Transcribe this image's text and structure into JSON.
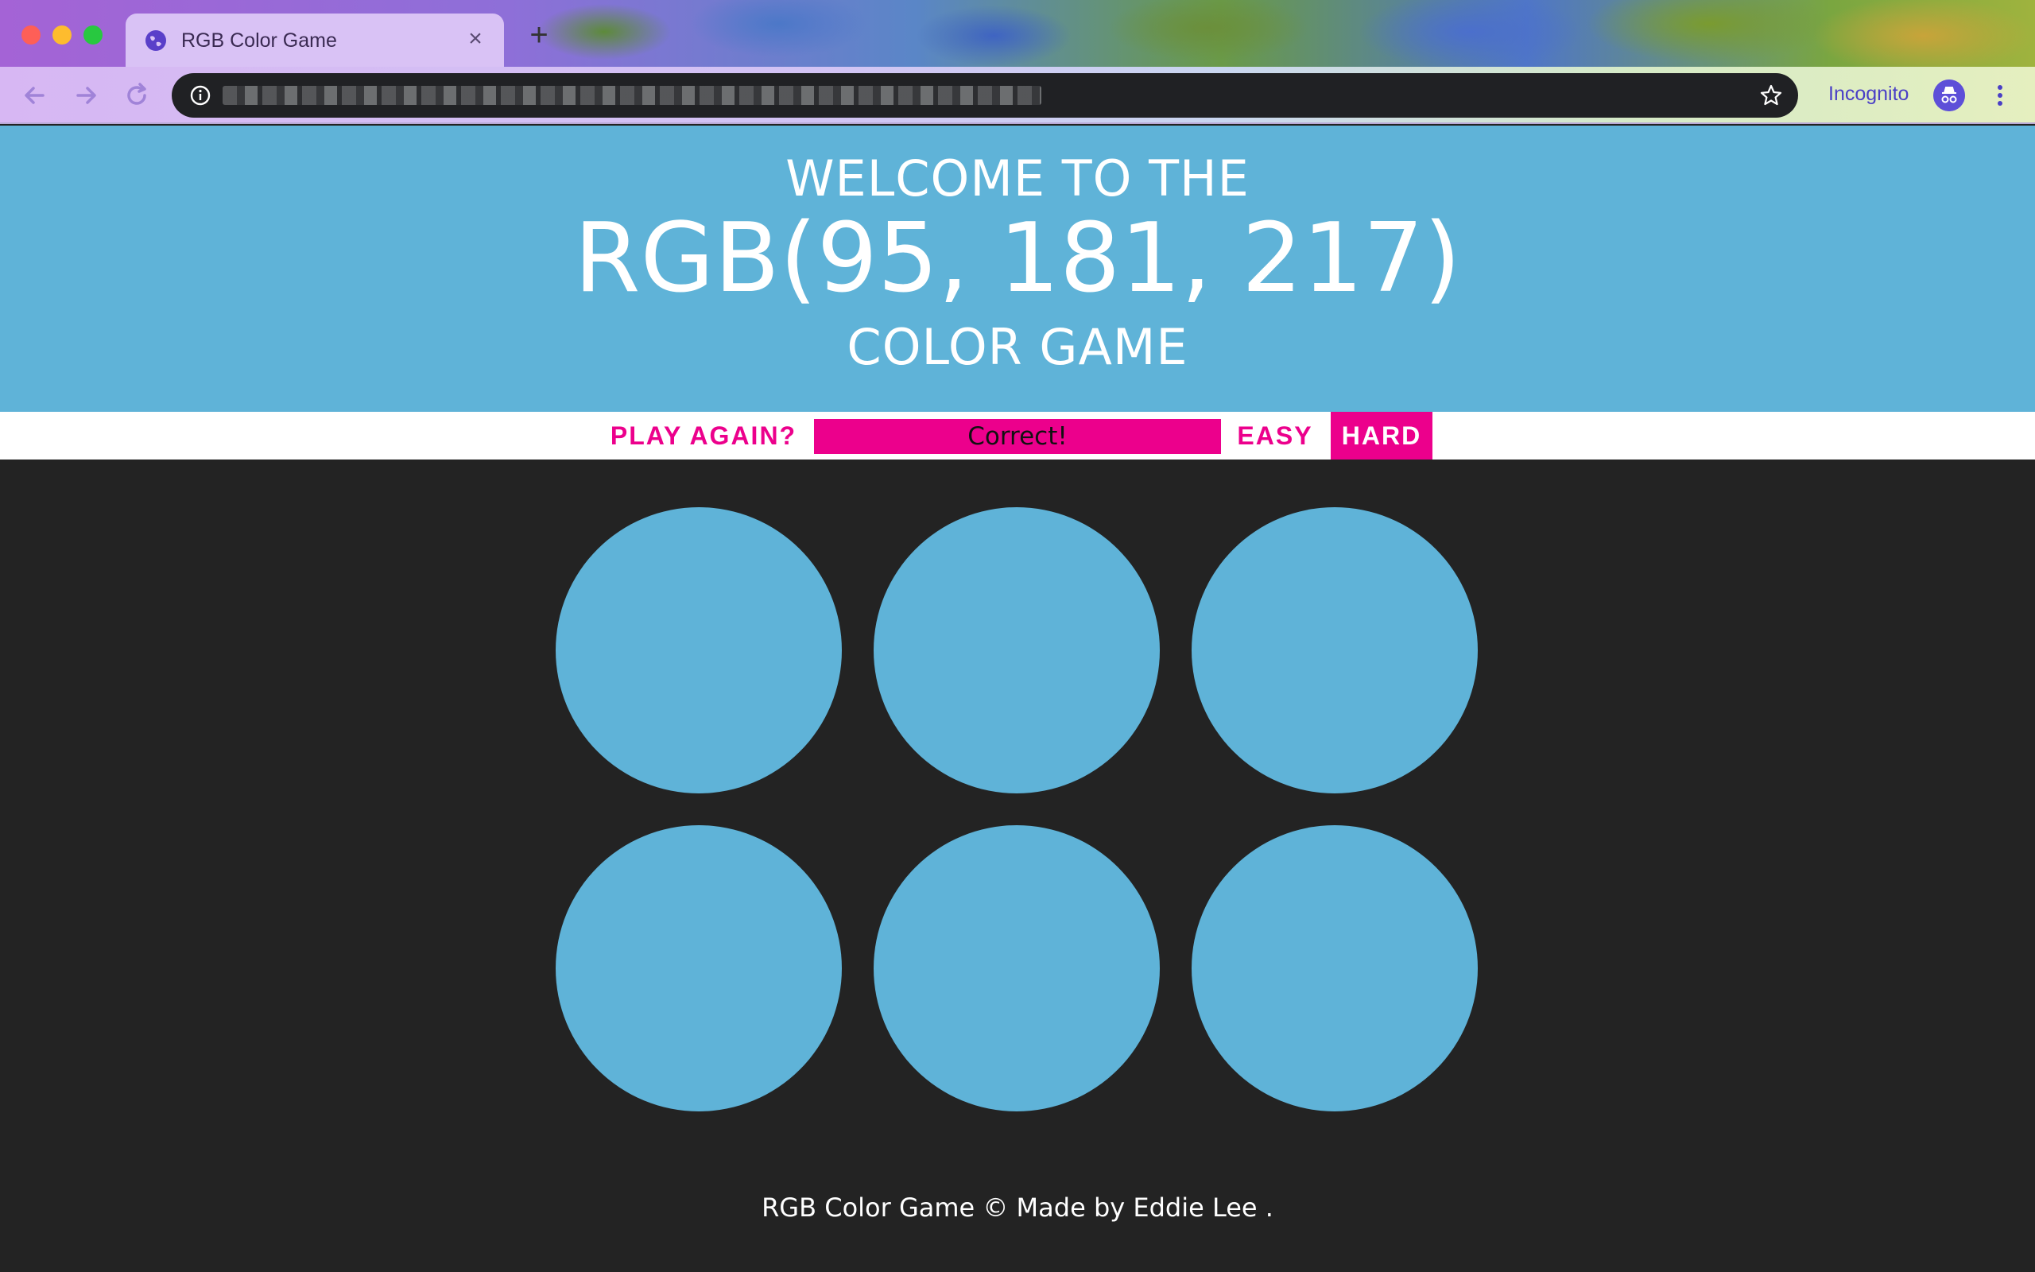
{
  "browser": {
    "tab_title": "RGB Color Game",
    "incognito_label": "Incognito",
    "icons": {
      "tab": "globe-icon",
      "close": "close-icon",
      "new_tab": "plus-icon",
      "back": "arrow-left-icon",
      "forward": "arrow-right-icon",
      "reload": "reload-icon",
      "info": "info-icon",
      "bookmark": "star-icon",
      "incognito": "incognito-icon",
      "menu": "kebab-menu-icon"
    }
  },
  "header": {
    "line1": "WELCOME TO THE",
    "rgb": "RGB(95, 181, 217)",
    "line3": "COLOR GAME",
    "background_color": "#5fb3d8"
  },
  "stripe": {
    "play_again": "PLAY AGAIN?",
    "message": "Correct!",
    "easy": "EASY",
    "hard": "HARD",
    "accent_color": "#ec008c",
    "selected_mode": "HARD"
  },
  "board": {
    "background_color": "#232323",
    "squares": [
      {
        "color": "#5fb3d8"
      },
      {
        "color": "#5fb3d8"
      },
      {
        "color": "#5fb3d8"
      },
      {
        "color": "#5fb3d8"
      },
      {
        "color": "#5fb3d8"
      },
      {
        "color": "#5fb3d8"
      }
    ]
  },
  "footer": {
    "text": "RGB Color Game © Made by Eddie Lee ."
  }
}
